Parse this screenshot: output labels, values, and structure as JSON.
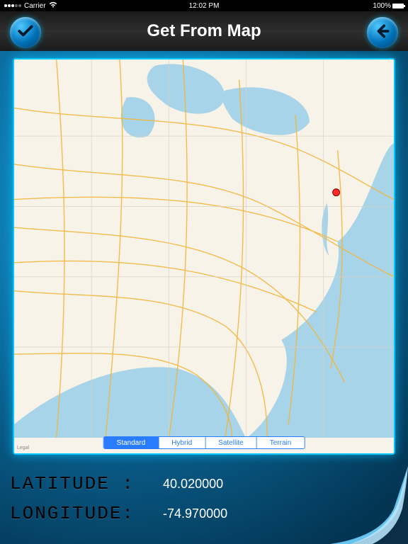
{
  "status": {
    "carrier": "Carrier",
    "time": "12:02 PM",
    "battery_pct": "100%"
  },
  "header": {
    "title": "Get From Map"
  },
  "map": {
    "segments": [
      "Standard",
      "Hybrid",
      "Satellite",
      "Terrain"
    ],
    "selected_segment": "Standard",
    "legal": "Legal",
    "pin": {
      "lat": 40.02,
      "lon": -74.97
    }
  },
  "coords": {
    "lat_label": "LATITUDE :",
    "lon_label": "LONGITUDE:",
    "lat_value": "40.020000",
    "lon_value": "-74.970000"
  }
}
